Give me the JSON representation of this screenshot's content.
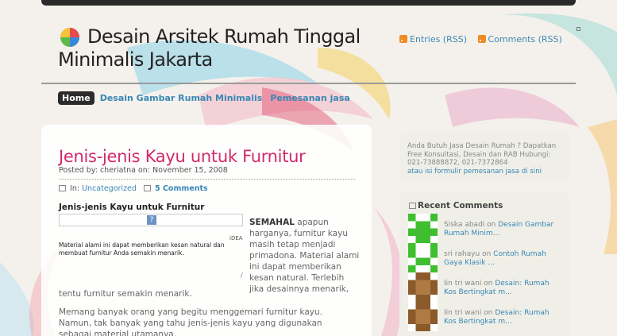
{
  "header": {
    "title_line1": "Desain Arsitek Rumah Tinggal",
    "title_line2": "Minimalis Jakarta",
    "rss_entries": "Entries (RSS)",
    "rss_comments": "Comments (RSS)"
  },
  "nav": {
    "items": [
      {
        "label": "Home"
      },
      {
        "label": "Desain Gambar Rumah Minimalis"
      },
      {
        "label": "Pemesanan jasa"
      }
    ]
  },
  "post": {
    "title": "Jenis-jenis Kayu untuk Furnitur",
    "meta": "Posted by: cheriatna on: November 15, 2008",
    "in_label": "In:",
    "category": "Uncategorized",
    "comments": "5 Comments",
    "subheading": "Jenis-jenis Kayu untuk Furnitur",
    "image_placeholder": "?",
    "image_idea": "iDEA",
    "image_caption": "Material alami ini dapat memberikan kesan natural dan membuat furnitur Anda semakin menarik.",
    "image_mark": "/",
    "intro_bold": "SEMAHAL",
    "intro_rest": " apapun harganya, furnitur kayu masih tetap menjadi primadona. Material alami ini dapat memberikan kesan natural. Terlebih jika desainnya menarik,",
    "intro_cont": "tentu furnitur semakin menarik.",
    "para2": "Memang banyak orang yang begitu menggemari furnitur kayu. Namun, tak banyak yang tahu jenis-jenis kayu yang digunakan sebagai material utamanya."
  },
  "sidebar": {
    "promo_text": "Anda Butuh Jasa Desain Rumah ? Dapatkan Free Konsultasi, Desain dan RAB Hubungi: 021-73888872, 021-7372864",
    "promo_link": "atau isi formulir pemesanan jasa di sini",
    "recent_title": "Recent Comments",
    "recent": [
      {
        "author": "Siska abadi",
        "on": " on ",
        "link": "Desain Gambar Rumah Minim..."
      },
      {
        "author": "sri rahayu",
        "on": " on ",
        "link": "Contoh Rumah Gaya Klasik ..."
      },
      {
        "author": "Iin tri wani",
        "on": " on ",
        "link": "Desain: Rumah Kos Bertingkat m..."
      },
      {
        "author": "Iin tri wani",
        "on": " on ",
        "link": "Desain: Rumah Kos Bertingkat m..."
      }
    ]
  },
  "icons": {
    "logo": "logo-icon",
    "rss": "rss-icon",
    "folder": "folder-icon",
    "comment": "comment-icon",
    "recent": "comments-icon",
    "avatar": "identicon-avatar"
  },
  "colors": {
    "accent_link": "#3a87b5",
    "post_title": "#d22a6a",
    "nav_active_bg": "#2b2b2b",
    "rss_orange": "#f08a24",
    "avatar_green": "#3fbf2f",
    "avatar_brown": "#8a5a2b"
  }
}
